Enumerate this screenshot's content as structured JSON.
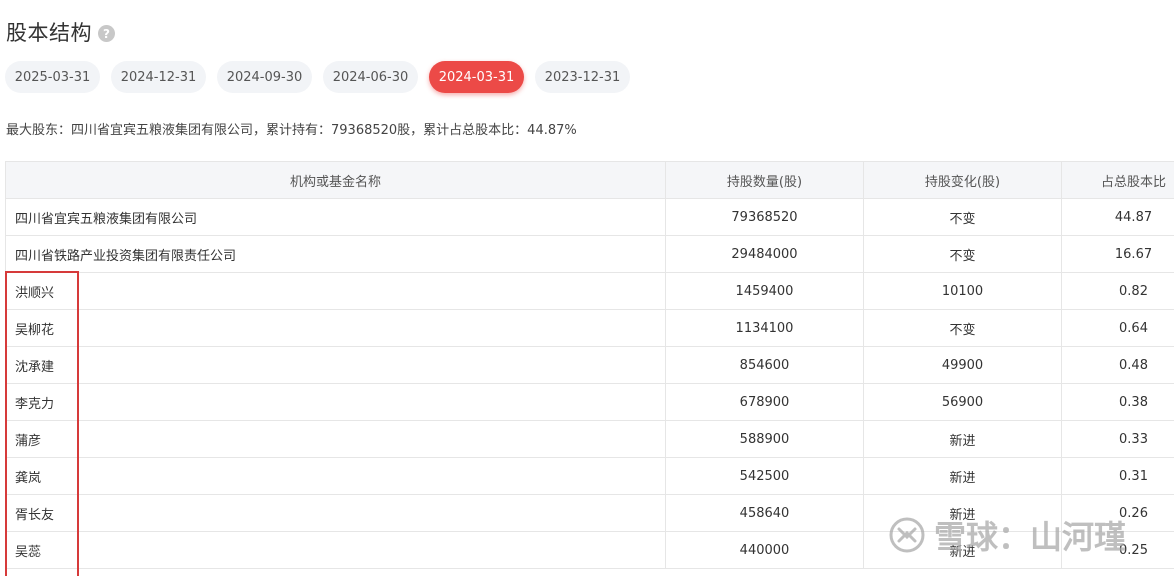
{
  "header": {
    "title": "股本结构",
    "help_icon": "?"
  },
  "tabs": [
    {
      "label": "2025-03-31",
      "active": false
    },
    {
      "label": "2024-12-31",
      "active": false
    },
    {
      "label": "2024-09-30",
      "active": false
    },
    {
      "label": "2024-06-30",
      "active": false
    },
    {
      "label": "2024-03-31",
      "active": true
    },
    {
      "label": "2023-12-31",
      "active": false
    }
  ],
  "summary": "最大股东：四川省宜宾五粮液集团有限公司，累计持有：79368520股，累计占总股本比：44.87%",
  "table": {
    "headers": [
      "机构或基金名称",
      "持股数量(股)",
      "持股变化(股)",
      "占总股本比"
    ],
    "rows": [
      [
        "四川省宜宾五粮液集团有限公司",
        "79368520",
        "不变",
        "44.87"
      ],
      [
        "四川省铁路产业投资集团有限责任公司",
        "29484000",
        "不变",
        "16.67"
      ],
      [
        "洪顺兴",
        "1459400",
        "10100",
        "0.82"
      ],
      [
        "吴柳花",
        "1134100",
        "不变",
        "0.64"
      ],
      [
        "沈承建",
        "854600",
        "49900",
        "0.48"
      ],
      [
        "李克力",
        "678900",
        "56900",
        "0.38"
      ],
      [
        "蒲彦",
        "588900",
        "新进",
        "0.33"
      ],
      [
        "龚岚",
        "542500",
        "新进",
        "0.31"
      ],
      [
        "胥长友",
        "458640",
        "新进",
        "0.26"
      ],
      [
        "吴蕊",
        "440000",
        "新进",
        "0.25"
      ]
    ]
  },
  "watermark": {
    "text": "雪球：山河瑾",
    "icon": "snowball-logo-icon"
  },
  "colors": {
    "accent": "#ec4a47",
    "tab_bg": "#f2f4f7",
    "header_bg": "#f5f6f8",
    "highlight": "#d63a3a"
  }
}
